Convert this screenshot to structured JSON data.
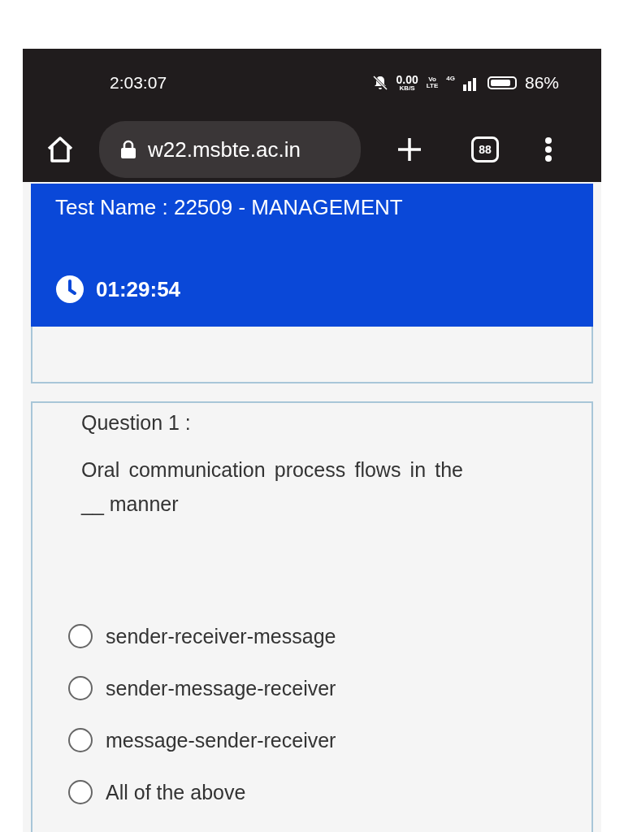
{
  "status_bar": {
    "time": "2:03:07",
    "speed": "0.00",
    "speed_unit": "KB/S",
    "volte_top": "Vo",
    "volte_bottom": "LTE",
    "network": "4G",
    "battery": "86%"
  },
  "browser": {
    "url": "w22.msbte.ac.in",
    "tab_count": "88"
  },
  "test": {
    "title": "Test Name : 22509 - MANAGEMENT",
    "timer": "01:29:54"
  },
  "question": {
    "label": "Question 1 :",
    "text": "Oral communication process flows in the __ manner",
    "options": [
      {
        "label": "sender-receiver-message",
        "selected": false
      },
      {
        "label": "sender-message-receiver",
        "selected": false
      },
      {
        "label": "message-sender-receiver",
        "selected": false
      },
      {
        "label": "All of the above",
        "selected": false
      }
    ]
  }
}
